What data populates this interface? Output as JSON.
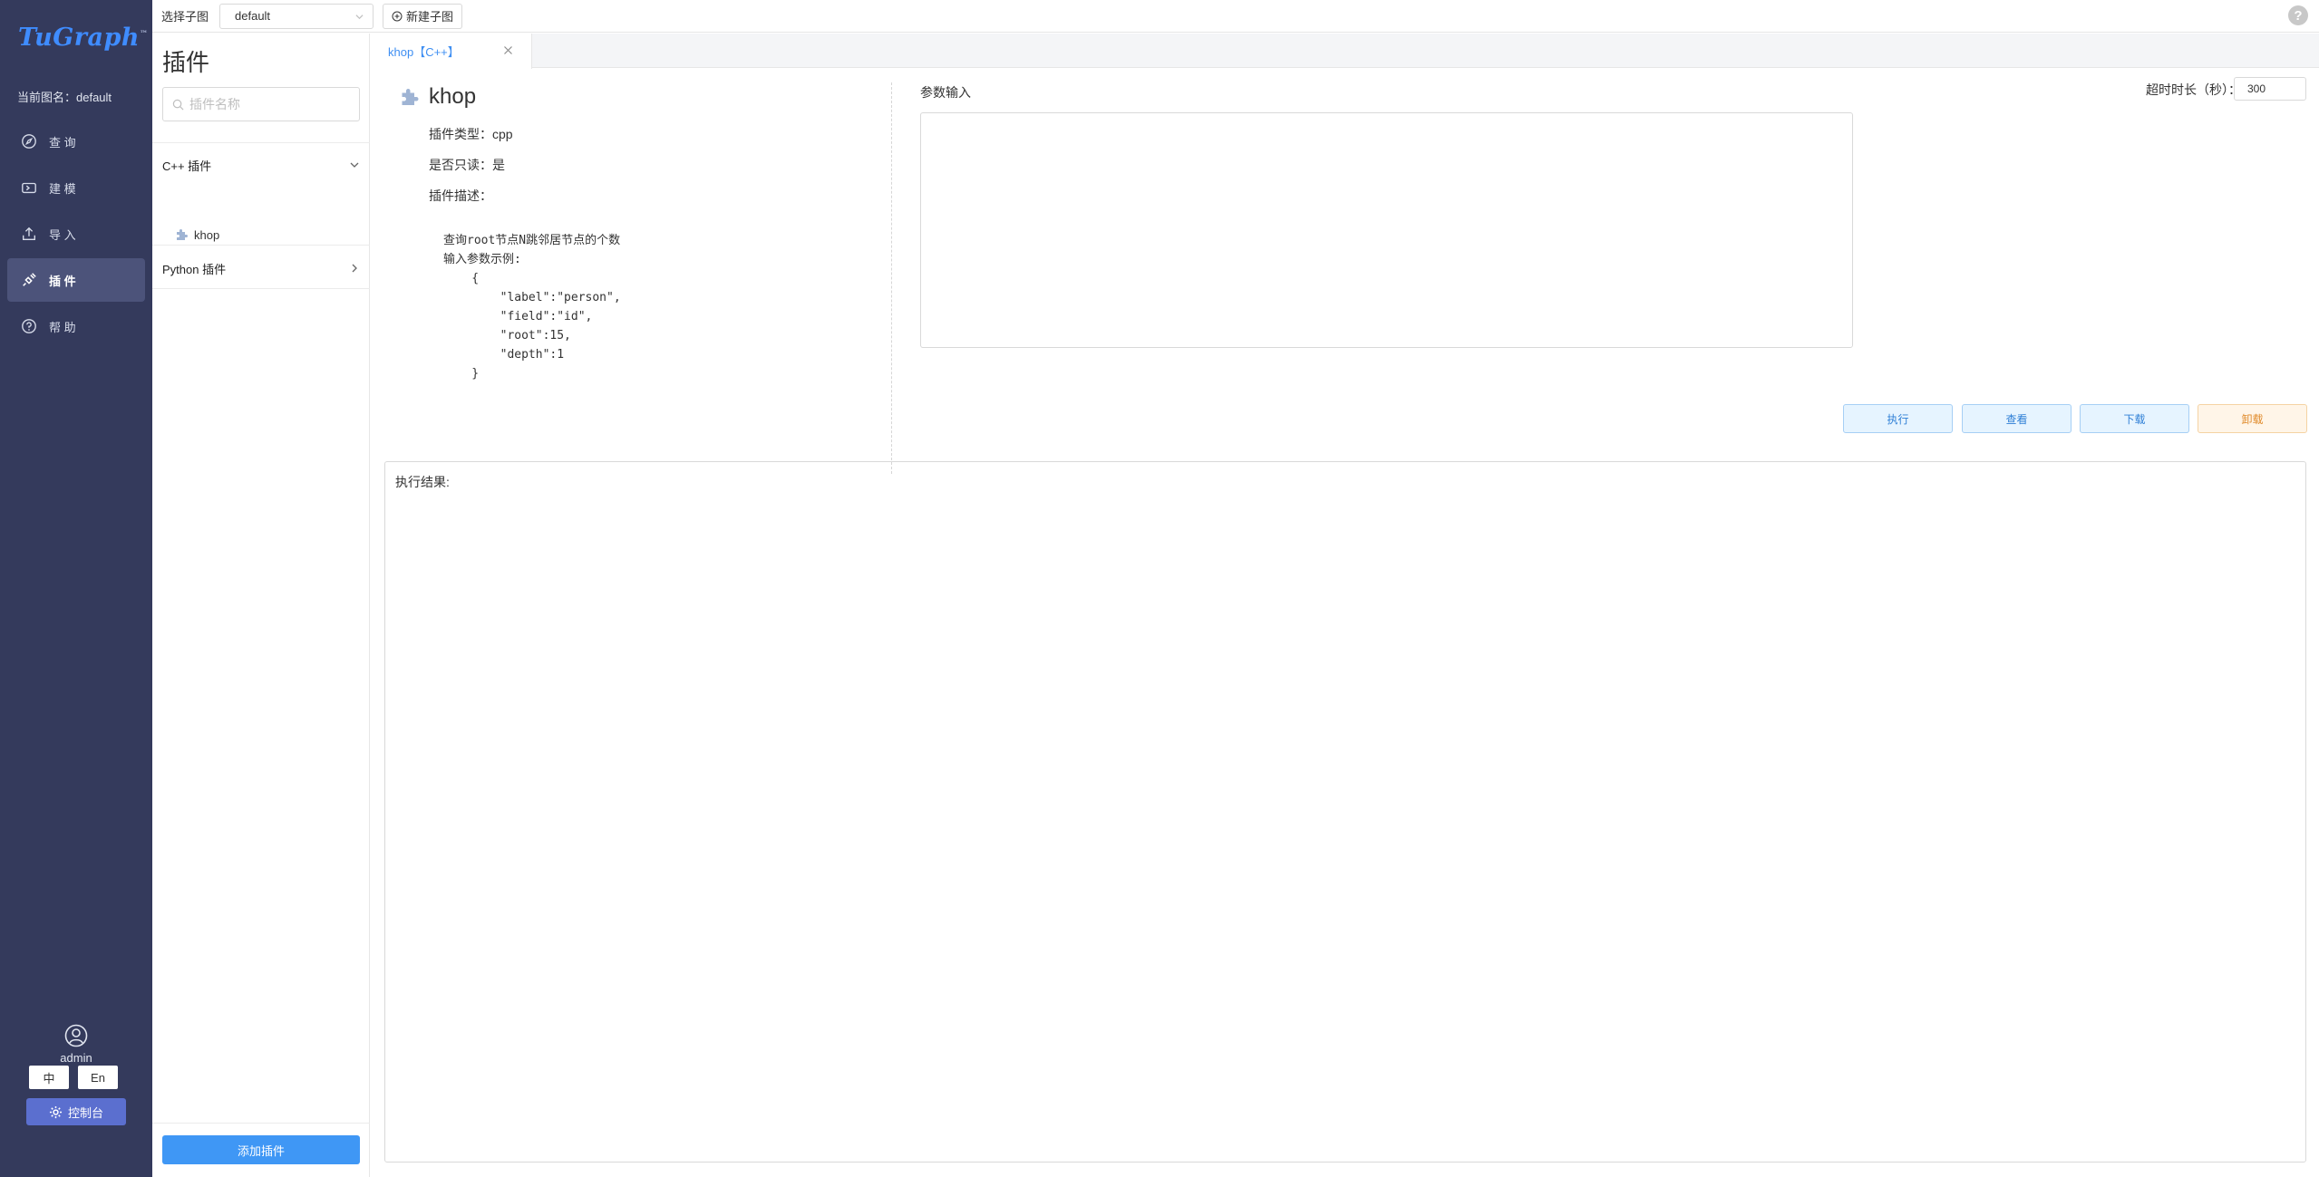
{
  "sidebar": {
    "logo": "TuGraph",
    "logo_tm": "™",
    "current_graph": "当前图名：default",
    "nav": [
      {
        "label": "查 询",
        "icon": "compass-icon"
      },
      {
        "label": "建 模",
        "icon": "model-icon"
      },
      {
        "label": "导 入",
        "icon": "upload-icon"
      },
      {
        "label": "插 件",
        "icon": "plugin-icon"
      },
      {
        "label": "帮 助",
        "icon": "help-circle-icon"
      }
    ],
    "user": "admin",
    "lang_zh": "中",
    "lang_en": "En",
    "console": "控制台"
  },
  "topbar": {
    "select_label": "选择子图",
    "select_value": "default",
    "new_subgraph": "新建子图",
    "help": "?"
  },
  "plugin_panel": {
    "title": "插件",
    "search_placeholder": "插件名称",
    "groups": [
      {
        "label": "C++ 插件",
        "expanded": true,
        "items": [
          "khop"
        ]
      },
      {
        "label": "Python 插件",
        "expanded": false,
        "items": []
      }
    ],
    "add_button": "添加插件"
  },
  "main": {
    "tab_label": "khop【C++】",
    "plugin_name": "khop",
    "type_line": "插件类型：cpp",
    "readonly_line": "是否只读：是",
    "desc_label": "插件描述：",
    "description": "查询root节点N跳邻居节点的个数\n输入参数示例:\n    {\n        \"label\":\"person\",\n        \"field\":\"id\",\n        \"root\":15,\n        \"depth\":1\n    }",
    "param_label": "参数输入",
    "timeout_label": "超时时长（秒）：",
    "timeout_value": "300",
    "buttons": {
      "execute": "执行",
      "view": "查看",
      "download": "下载",
      "unload": "卸载"
    },
    "result_label": "执行结果:"
  },
  "colors": {
    "sidebar_bg": "#343a5c",
    "accent": "#3f97f5",
    "unload": "#e08a2a"
  }
}
